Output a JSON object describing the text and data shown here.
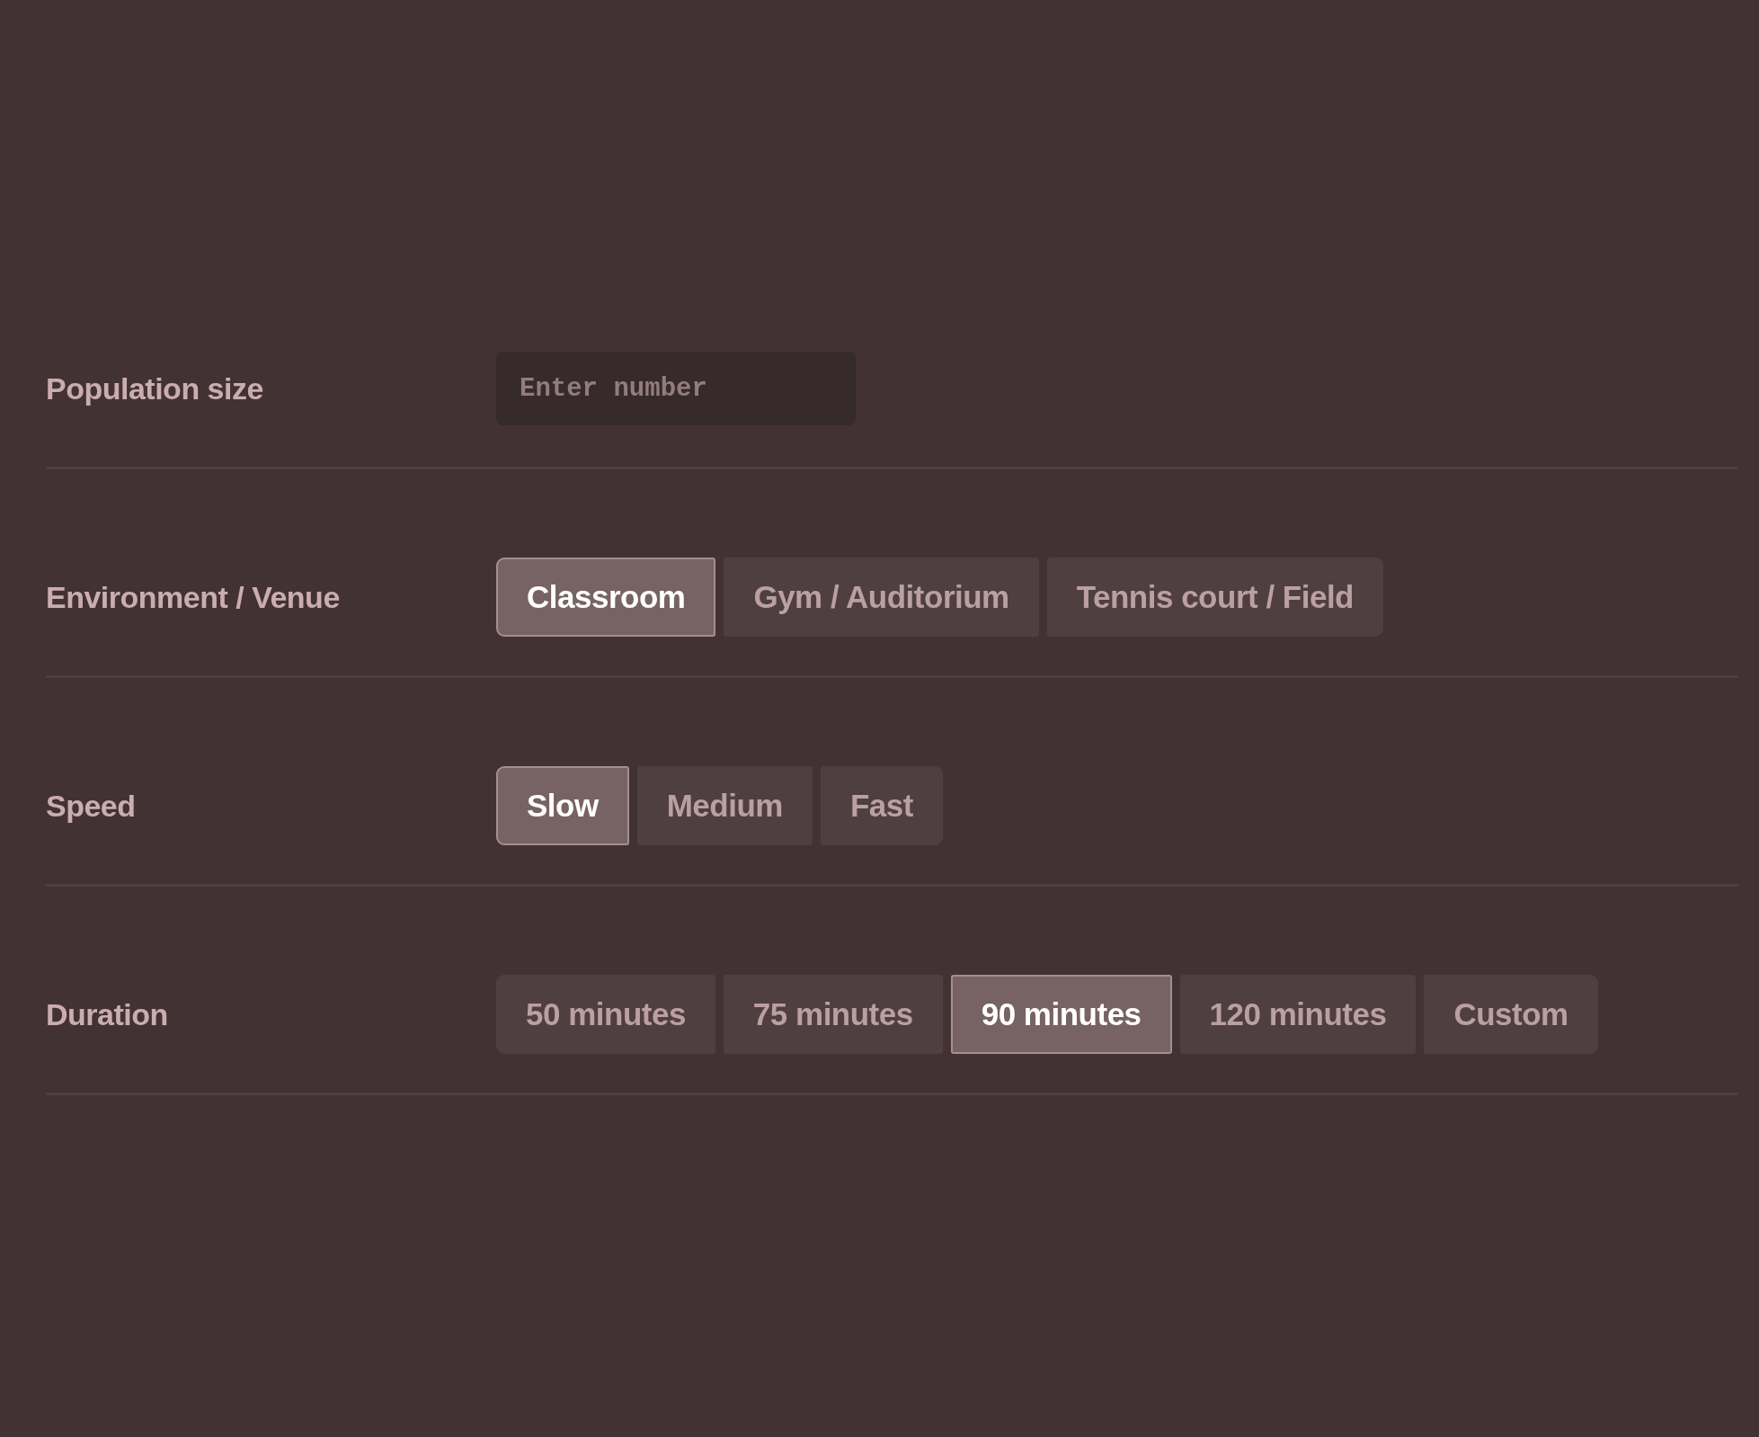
{
  "fields": [
    {
      "kind": "input",
      "label": "Population size",
      "placeholder": "Enter number"
    },
    {
      "kind": "options",
      "label": "Environment / Venue",
      "options": [
        {
          "label": "Classroom",
          "selected": true
        },
        {
          "label": "Gym / Auditorium",
          "selected": false
        },
        {
          "label": "Tennis court / Field",
          "selected": false
        }
      ]
    },
    {
      "kind": "options",
      "label": "Speed",
      "options": [
        {
          "label": "Slow",
          "selected": true
        },
        {
          "label": "Medium",
          "selected": false
        },
        {
          "label": "Fast",
          "selected": false
        }
      ]
    },
    {
      "kind": "options",
      "label": "Duration",
      "options": [
        {
          "label": "50 minutes",
          "selected": false
        },
        {
          "label": "75 minutes",
          "selected": false
        },
        {
          "label": "90 minutes",
          "selected": true
        },
        {
          "label": "120 minutes",
          "selected": false
        },
        {
          "label": "Custom",
          "selected": false
        }
      ]
    }
  ]
}
